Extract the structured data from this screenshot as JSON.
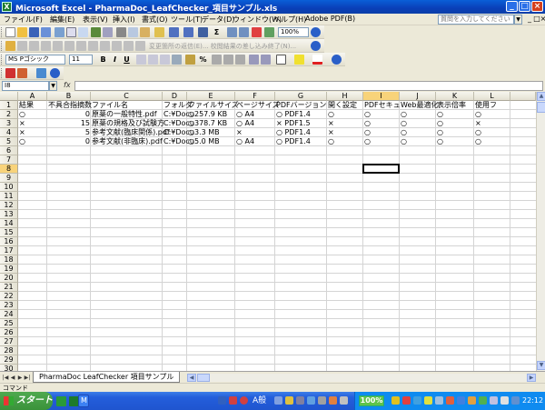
{
  "window": {
    "title": "Microsoft Excel - PharmaDoc_LeafChecker_項目サンプル.xls",
    "app_icon": "X",
    "buttons": [
      "_",
      "□",
      "×"
    ]
  },
  "menu": {
    "items": [
      "ファイル(F)",
      "編集(E)",
      "表示(V)",
      "挿入(I)",
      "書式(O)",
      "ツール(T)",
      "データ(D)",
      "ウィンドウ(W)",
      "ヘルプ(H)",
      "Adobe PDF(B)"
    ],
    "help_placeholder": "質問を入力してください",
    "doc_buttons": [
      "_",
      "□",
      "×"
    ]
  },
  "toolbar": {
    "zoom": "100%",
    "review_text": "変更箇所の返信(E)... 校閲結果の差し込み終了(N)..."
  },
  "format_toolbar": {
    "font_name": "MS Pゴシック",
    "font_size": "11",
    "bold": "B",
    "italic": "I",
    "underline": "U",
    "percent": "%"
  },
  "formula_bar": {
    "name_box": "I8",
    "fx": "fx",
    "content": ""
  },
  "columns": [
    "A",
    "B",
    "C",
    "D",
    "E",
    "F",
    "G",
    "H",
    "I",
    "J",
    "K",
    "L"
  ],
  "selected_column": "I",
  "selected_row": 8,
  "row_count": 40,
  "header_row": [
    "結果",
    "不具合指摘数",
    "ファイル名",
    "フォルダ",
    "ファイルサイズ",
    "ページサイズ",
    "PDFバージョン",
    "開く設定",
    "PDFセキュ",
    "Web最適化",
    "表示倍率",
    "使用フ"
  ],
  "data_rows": [
    [
      "○",
      "0",
      "原薬の一般特性.pdf",
      "C:¥Docu",
      "○257.9 KB",
      "○  A4",
      "○  PDF1.4",
      "○",
      "○",
      "○",
      "○",
      "○"
    ],
    [
      "×",
      "15",
      "原薬の規格及び試験方",
      "C:¥Docu",
      "○378.7 KB",
      "○  A4",
      "×  PDF1.5",
      "×",
      "○",
      "○",
      "○",
      "×"
    ],
    [
      "×",
      "5",
      "参考文献(臨床関係).pdf",
      "C:¥Docu",
      "○3.3 MB",
      "×",
      "○  PDF1.4",
      "×",
      "○",
      "○",
      "○",
      "○"
    ],
    [
      "○",
      "0",
      "参考文献(非臨床).pdf",
      "C:¥Docu",
      "○5.0 MB",
      "○  A4",
      "○  PDF1.4",
      "○",
      "○",
      "○",
      "○",
      "○"
    ]
  ],
  "sheet_tab": "PharmaDoc LeafChecker 項目サンプル",
  "status": "コマンド",
  "taskbar": {
    "start": "スタート",
    "task_button": "M",
    "ime": "A般",
    "zoom_badge": "100%",
    "clock": "22:12"
  }
}
